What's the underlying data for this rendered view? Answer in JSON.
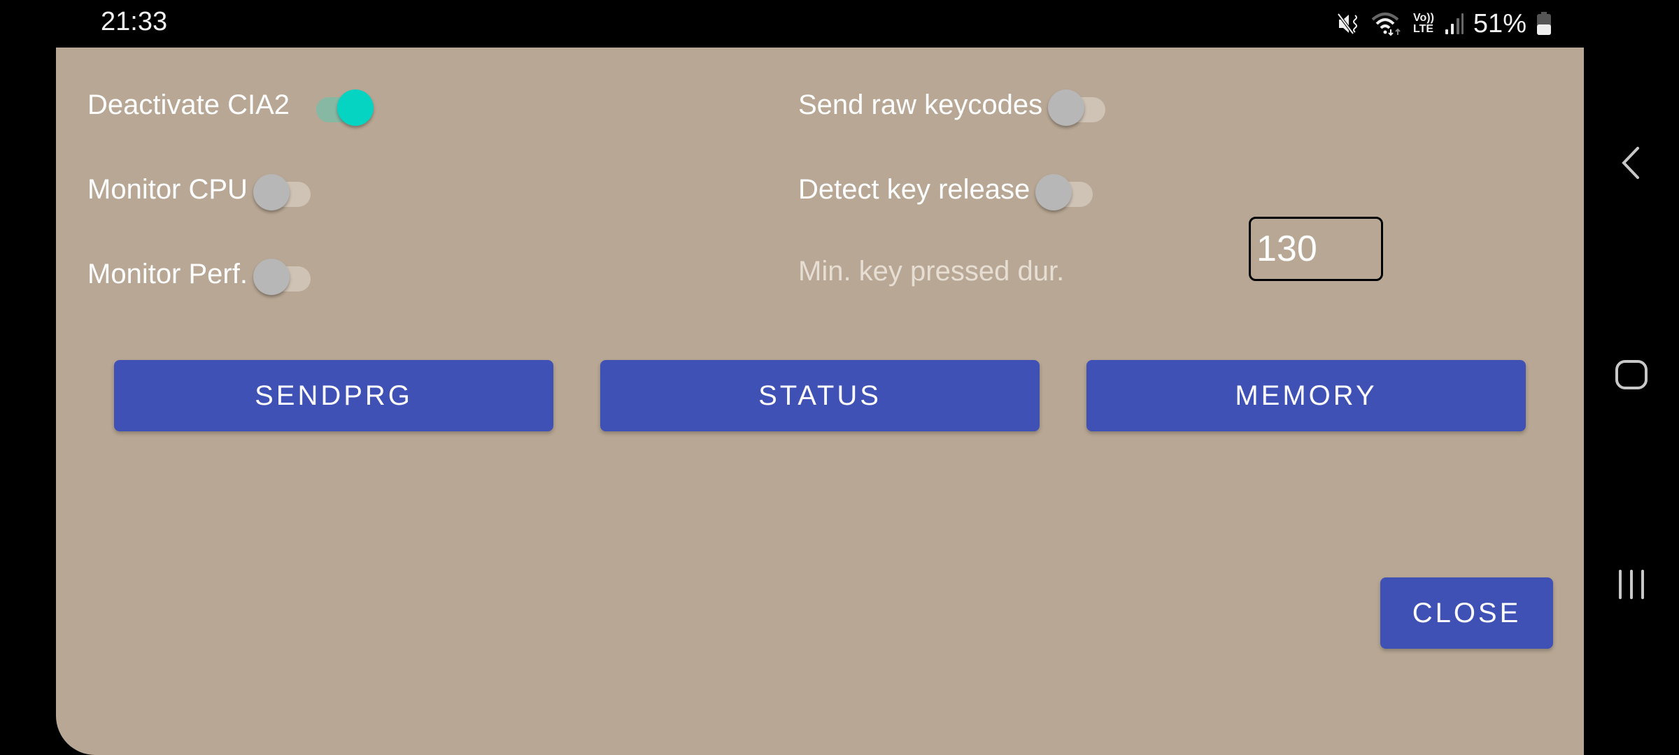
{
  "status_bar": {
    "time": "21:33",
    "icons": [
      "mute-vibrate-icon",
      "wifi-icon",
      "volte-lte-icon",
      "signal-icon",
      "battery-icon"
    ],
    "volte_top": "Vo))",
    "volte_bottom": "LTE",
    "battery_percent": "51%"
  },
  "dialog": {
    "background_color": "#b8a794",
    "accent_color": "#06d4c2",
    "button_color": "#3f51b5",
    "toggles": [
      {
        "label": "Deactivate CIA2",
        "on": true
      },
      {
        "label": "Monitor CPU",
        "on": false
      },
      {
        "label": "Monitor Perf.",
        "on": false
      },
      {
        "label": "Send raw keycodes",
        "on": false
      },
      {
        "label": "Detect key release",
        "on": false
      }
    ],
    "min_key_pressed": {
      "label": "Min. key pressed dur.",
      "value": "130"
    },
    "buttons": {
      "sendprg": "SENDPRG",
      "status": "STATUS",
      "memory": "MEMORY",
      "close": "CLOSE"
    }
  },
  "nav_bar": {
    "buttons": [
      "back-icon",
      "home-icon",
      "recents-icon"
    ]
  }
}
